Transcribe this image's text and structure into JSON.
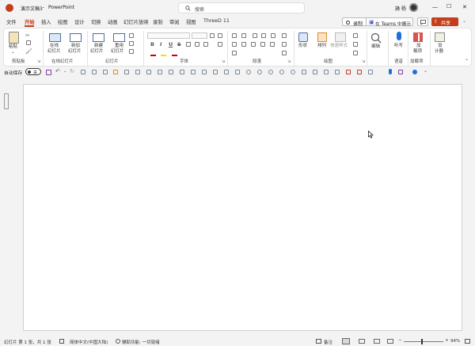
{
  "title": {
    "document": "演示文稿3",
    "sep": "-",
    "app": "PowerPoint",
    "search_placeholder": "搜索",
    "user": "旖 杨",
    "min": "—",
    "max": "☐",
    "close": "✕"
  },
  "tabs": [
    {
      "label": "文件"
    },
    {
      "label": "开始"
    },
    {
      "label": "插入"
    },
    {
      "label": "绘图"
    },
    {
      "label": "设计"
    },
    {
      "label": "切换"
    },
    {
      "label": "动画"
    },
    {
      "label": "幻灯片放映"
    },
    {
      "label": "录制"
    },
    {
      "label": "审阅"
    },
    {
      "label": "视图"
    },
    {
      "label": "ThreeD 11"
    }
  ],
  "top_buttons": {
    "record": "录制",
    "teams": "在 Teams 中展示",
    "share": "共享"
  },
  "ribbon": {
    "paste": "粘贴",
    "clipboard": "剪贴板",
    "online_slides_btn1": "在线",
    "online_slides_btn2": "幻灯片",
    "add_slides1": "新加",
    "add_slides2": "幻灯片",
    "online_group": "在线幻灯片",
    "new_slide1": "新建",
    "new_slide2": "幻灯片",
    "reuse1": "重用",
    "reuse2": "幻灯片",
    "slides_group": "幻灯片",
    "font_group": "字体",
    "paragraph_group": "段落",
    "shape": "形状",
    "arrange": "排列",
    "quick_styles": "快速样式",
    "drawing_group": "绘图",
    "edit": "编辑",
    "dictate": "听写",
    "voice_group": "语音",
    "addins1": "加",
    "addins2": "载项",
    "addins_group": "加载项",
    "designer1": "设",
    "designer2": "计器",
    "bold": "B",
    "italic": "I",
    "underline": "U",
    "strike": "S"
  },
  "qat": {
    "autosave": "自动保存",
    "toggle": "关"
  },
  "status": {
    "slide_info": "幻灯片 第 1 张，共 1 张",
    "language": "简体中文(中国大陆)",
    "accessibility": "辅助功能: 一切就绪",
    "notes": "备注",
    "zoom": "94%"
  },
  "colors": {
    "accent": "#c43e1c",
    "share": "#c43e1c",
    "background": "#f3f3f3",
    "slide": "#ffffff"
  }
}
